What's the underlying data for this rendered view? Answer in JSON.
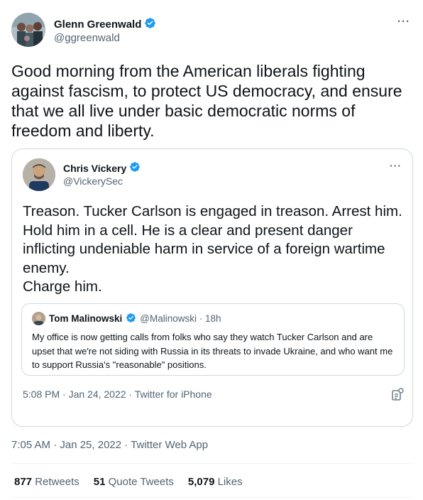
{
  "tweet": {
    "author_name": "Glenn Greenwald",
    "author_handle": "@ggreenwald",
    "more_label": "···",
    "text": "Good morning from the American liberals fighting against fascism, to protect US democracy, and ensure that we all live under basic democratic norms of freedom and liberty.",
    "timestamp": "7:05 AM · Jan 25, 2022 · Twitter Web App",
    "stats": [
      {
        "count": "877",
        "label": "Retweets"
      },
      {
        "count": "51",
        "label": "Quote Tweets"
      },
      {
        "count": "5,079",
        "label": "Likes"
      }
    ]
  },
  "quoted": {
    "author_name": "Chris Vickery",
    "author_handle": "@VickerySec",
    "more_label": "···",
    "text_lines": [
      "Treason. Tucker Carlson is engaged in treason. Arrest him. Hold him in a cell. He is a clear and present danger inflicting undeniable harm in service of a foreign wartime enemy.",
      "Charge him."
    ],
    "meta": "5:08 PM · Jan 24, 2022 · Twitter for iPhone",
    "inner": {
      "author_name": "Tom Malinowski",
      "author_handle": "@Malinowski · 18h",
      "text": "My office is now getting calls from folks who say they watch Tucker Carlson and are upset that we're not siding with Russia in its threats to invade Ukraine, and who want me to support Russia's \"reasonable\" positions."
    }
  },
  "icons": {
    "verified": "verified-badge-icon",
    "more": "more-options-icon",
    "analytics": "analytics-icon"
  },
  "colors": {
    "verified_blue": "#1d9bf0",
    "secondary_text": "#536471",
    "border": "#cfd9de"
  }
}
